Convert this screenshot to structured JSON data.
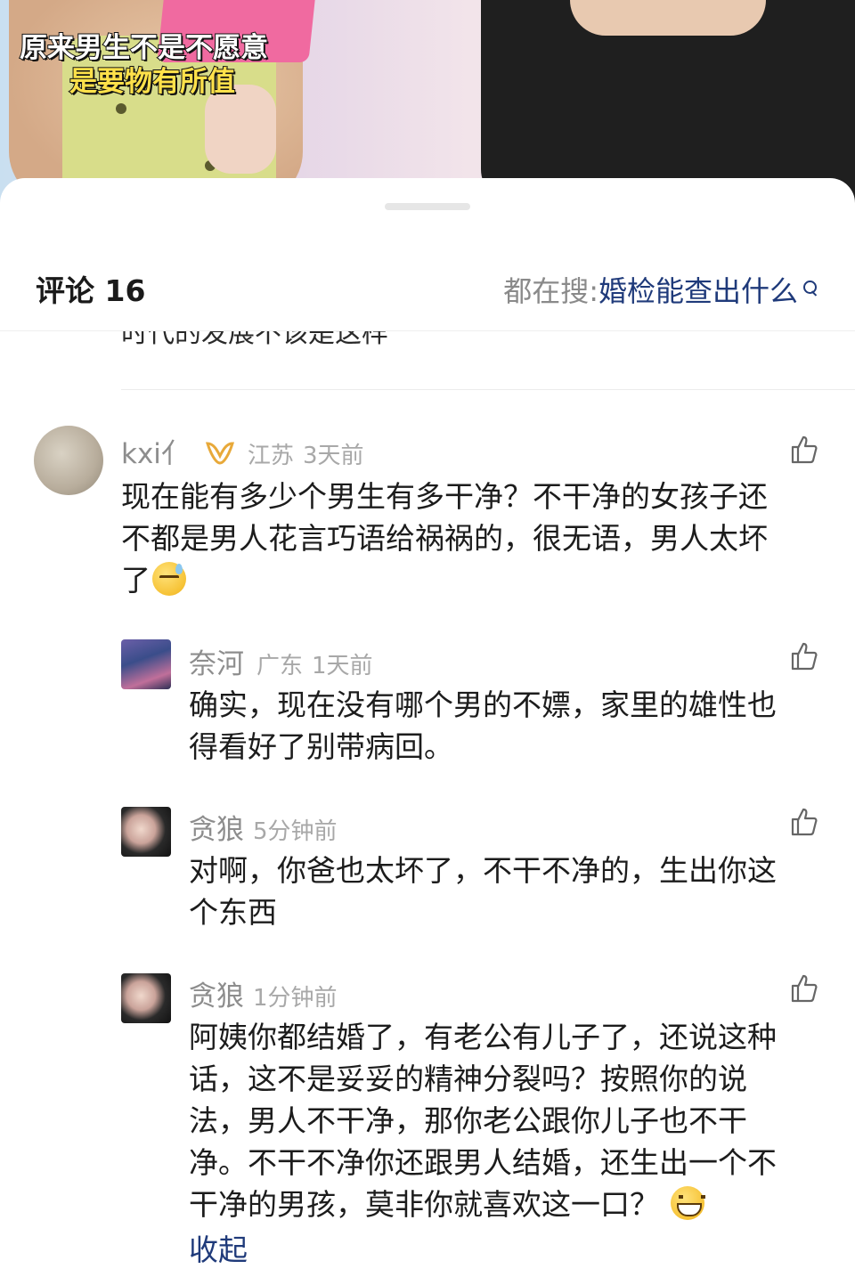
{
  "video": {
    "caption_line1": "原来男生不是不愿意",
    "caption_line2": "是要物有所值"
  },
  "header": {
    "title": "评论 16",
    "search_label": "都在搜: ",
    "search_query": "婚检能查出什么",
    "search_icon": "search-icon"
  },
  "partial_comment": "时代的发展不该是这样",
  "comments": [
    {
      "name": "kxi亻",
      "badge": "ꟾ",
      "location": "江苏",
      "time": "3天前",
      "line1": "现在能有多少个男生有多干净？不干净的女孩子还",
      "line2": "不都是男人花言巧语给祸祸的，很无语，男人太坏",
      "line3": "了",
      "emoji": "sweat-smile-emoji",
      "like_icon": "thumbs-up-icon"
    },
    {
      "name": "奈河",
      "location": "广东",
      "time": "1天前",
      "line1": "确实，现在没有哪个男的不嫖，家里的雄性也",
      "line2": "得看好了别带病回。",
      "like_icon": "thumbs-up-icon"
    },
    {
      "name": "贪狼",
      "time": "5分钟前",
      "line1": "对啊，你爸也太坏了，不干不净的，生出你这",
      "line2": "个东西",
      "like_icon": "thumbs-up-icon"
    },
    {
      "name": "贪狼",
      "time": "1分钟前",
      "line1": "阿姨你都结婚了，有老公有儿子了，还说这种",
      "line2": "话，这不是妥妥的精神分裂吗？按照你的说",
      "line3": "法，男人不干净，那你老公跟你儿子也不干",
      "line4": "净。不干不净你还跟男人结婚，还生出一个不",
      "line5": "干净的男孩，莫非你就喜欢这一口？",
      "emoji": "grin-emoji",
      "collapse": "收起",
      "like_icon": "thumbs-up-icon"
    }
  ],
  "colors": {
    "link": "#1f3a7a",
    "meta": "#8d8d8d",
    "badge": "#e8a93a"
  }
}
